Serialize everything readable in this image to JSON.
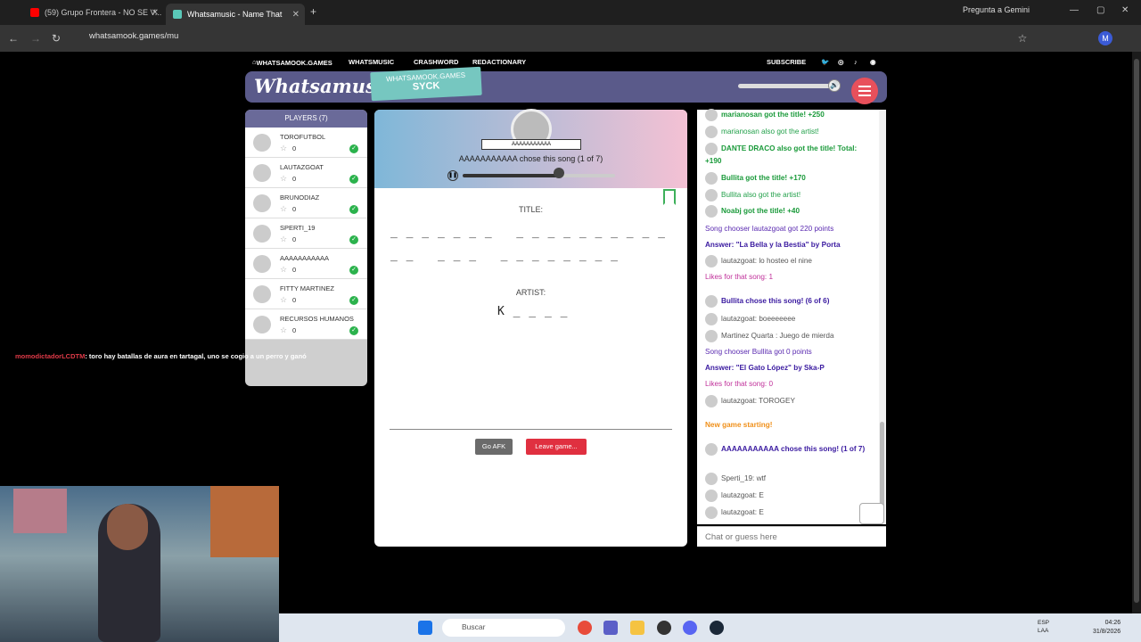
{
  "browser": {
    "tabs": [
      {
        "title": "(59) Grupo Frontera - NO SE V...",
        "active": false
      },
      {
        "title": "Whatsamusic - Name That",
        "active": true
      }
    ],
    "url": "whatsamook.games/mu",
    "gemini_label": "Pregunta a Gemini"
  },
  "site": {
    "nav": [
      "WHATSAMOOK.GAMES",
      "WHATSMUSIC",
      "CRASHWORD",
      "REDACTIONARY"
    ],
    "subscribe": "SUBSCRIBE",
    "logo": "Whatsamusic",
    "room_top": "WHATSAMOOK.GAMES",
    "room_name": "SYCK"
  },
  "players": {
    "header": "PLAYERS (7)",
    "list": [
      {
        "name": "TOROFUTBOL",
        "score": "0"
      },
      {
        "name": "LAUTAZGOAT",
        "score": "0"
      },
      {
        "name": "BRUNODIAZ",
        "score": "0"
      },
      {
        "name": "SPERTI_19",
        "score": "0"
      },
      {
        "name": "AAAAAAAAAAA",
        "score": "0"
      },
      {
        "name": "FITTY MARTINEZ",
        "score": "0"
      },
      {
        "name": "RECURSOS HUMANOS",
        "score": "0"
      }
    ]
  },
  "game": {
    "chooser_name": "AAAAAAAAAAA",
    "chose_text": "AAAAAAAAAAA chose this song (1 of 7)",
    "progress": 0.63,
    "title_label": "TITLE:",
    "title_line1": "_ _ _ _ _ _ _   _ _ _ _ _ _ _ _ _ _",
    "title_line2": "_ _   _ _ _   _ _ _ _ _ _ _ _",
    "artist_label": "ARTIST:",
    "artist_line": "K _ _ _ _",
    "afk_label": "Go AFK",
    "leave_label": "Leave game..."
  },
  "chat": {
    "messages": [
      {
        "text": "marianosan got the title! +250",
        "style": "greenb",
        "avatar": true
      },
      {
        "text": "marianosan also got the artist!",
        "style": "green",
        "avatar": true
      },
      {
        "text": "DANTE DRACO also got the title! Total: +190",
        "style": "greenb",
        "avatar": true
      },
      {
        "text": "Bullita got the title! +170",
        "style": "greenb",
        "avatar": true
      },
      {
        "text": "Bullita also got the artist!",
        "style": "green",
        "avatar": true
      },
      {
        "text": "Noabj got the title! +40",
        "style": "greenb",
        "avatar": true
      },
      {
        "text": "Song chooser lautazgoat got 220 points",
        "style": "purple",
        "avatar": false
      },
      {
        "text": "Answer: \"La Bella y la Bestia\" by Porta",
        "style": "purpleb",
        "avatar": false
      },
      {
        "text": "lautazgoat: lo hosteo el nine",
        "style": "gray",
        "avatar": true
      },
      {
        "text": "Likes for that song: 1",
        "style": "pink",
        "avatar": false
      },
      {
        "text": "Bullita chose this song! (6 of 6)",
        "style": "purpleb",
        "avatar": true
      },
      {
        "text": "lautazgoat: boeeeeeee",
        "style": "gray",
        "avatar": true
      },
      {
        "text": "Martinez Quarta : Juego de mierda",
        "style": "gray",
        "avatar": true
      },
      {
        "text": "Song chooser Bullita got 0 points",
        "style": "purple",
        "avatar": false
      },
      {
        "text": "Answer: \"El Gato López\" by Ska-P",
        "style": "purpleb",
        "avatar": false
      },
      {
        "text": "Likes for that song: 0",
        "style": "pink",
        "avatar": false
      },
      {
        "text": "lautazgoat: TOROGEY",
        "style": "gray",
        "avatar": true
      },
      {
        "text": "New game starting!",
        "style": "orange",
        "avatar": false
      },
      {
        "text": "AAAAAAAAAAA chose this song! (1 of 7)",
        "style": "purpleb",
        "avatar": true
      },
      {
        "text": "Sperti_19: wtf",
        "style": "gray",
        "avatar": true
      },
      {
        "text": "lautazgoat: E",
        "style": "gray",
        "avatar": true
      },
      {
        "text": "lautazgoat: E",
        "style": "gray",
        "avatar": true
      }
    ],
    "placeholder": "Chat or guess here"
  },
  "stream": {
    "user": "momodictadorLCDTM",
    "message": ": toro hay batallas de aura en tartagal, uno se cogio a un perro y ganó"
  },
  "taskbar": {
    "search": "Buscar",
    "lang": "ESP\nLAA",
    "time": "04:26",
    "date": "31/8/2026"
  }
}
